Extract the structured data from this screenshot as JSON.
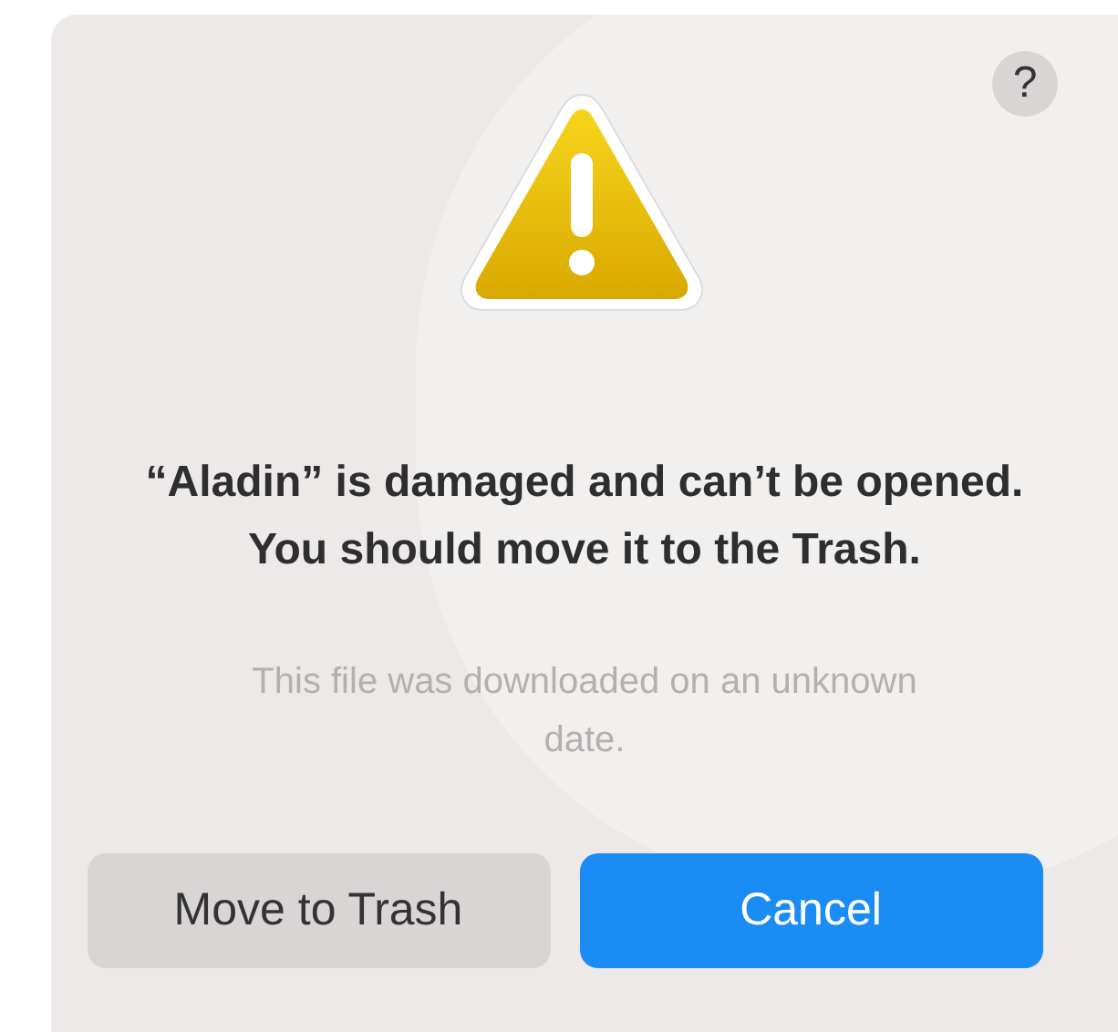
{
  "dialog": {
    "help_button": "?",
    "title": "“Aladin” is damaged and can’t be opened. You should move it to the Trash.",
    "message": "This file was downloaded on an unknown date.",
    "buttons": [
      {
        "label": "Move to Trash",
        "kind": "secondary"
      },
      {
        "label": "Cancel",
        "kind": "primary"
      }
    ]
  }
}
